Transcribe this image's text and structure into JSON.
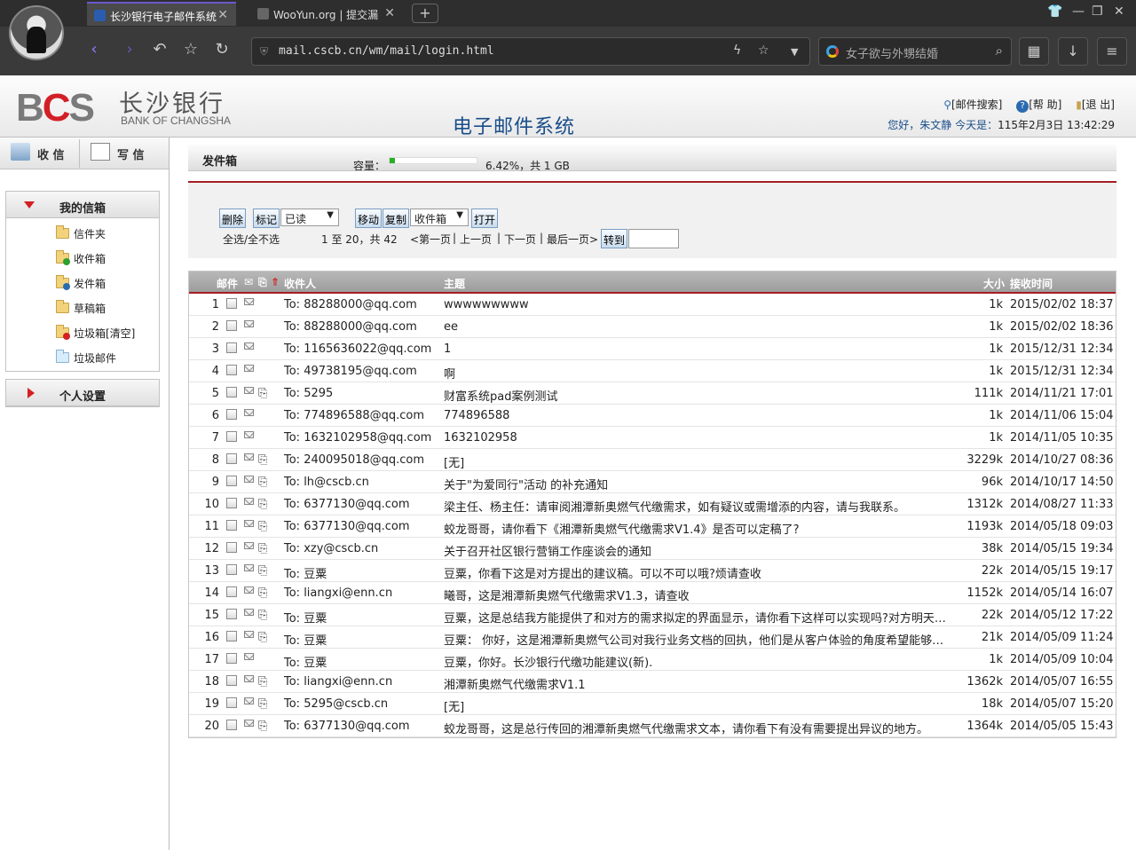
{
  "browser": {
    "tabs": [
      {
        "label": "长沙银行电子邮件系统",
        "active": true
      },
      {
        "label": "WooYun.org | 提交漏",
        "active": false
      }
    ],
    "url": "mail.cscb.cn/wm/mail/login.html",
    "search_placeholder": "女子欲与外甥结婚"
  },
  "header": {
    "logo_cn": "长沙银行",
    "logo_en": "BANK OF CHANGSHA",
    "system_title": "电子邮件系统",
    "links": {
      "search": "[邮件搜索]",
      "help": "[帮 助]",
      "logout": "[退 出]"
    },
    "greeting": "您好，朱文静 今天是：",
    "date": "115年2月3日 13:42:29"
  },
  "sidebar": {
    "receive": "收 信",
    "compose": "写 信",
    "mybox_title": "我的信箱",
    "folders": [
      {
        "label": "信件夹",
        "kind": "yellow"
      },
      {
        "label": "收件箱",
        "kind": "yellow"
      },
      {
        "label": "发件箱",
        "kind": "yellow"
      },
      {
        "label": "草稿箱",
        "kind": "yellow"
      },
      {
        "label": "垃圾箱[清空]",
        "kind": "yellow"
      },
      {
        "label": "垃圾邮件",
        "kind": "blue"
      }
    ],
    "settings_title": "个人设置"
  },
  "main": {
    "box_title": "发件箱",
    "capacity_label": "容量：",
    "capacity_percent": 6.42,
    "capacity_text": "6.42%，共 1 GB",
    "toolbar": {
      "delete": "删除",
      "mark": "标记",
      "mark_value": "已读",
      "move": "移动",
      "copy": "复制",
      "folder_value": "收件箱",
      "open": "打开",
      "select_all": "全选/全不选",
      "range": "1 至 20，共 42",
      "first": "<第一页",
      "prev": "上一页",
      "next": "下一页",
      "last": "最后一页>",
      "goto": "转到"
    },
    "columns": {
      "mail": "邮件",
      "to": "收件人",
      "subject": "主题",
      "size": "大小",
      "time": "接收时间"
    },
    "rows": [
      {
        "n": "1",
        "to": "To: 88288000@qq.com",
        "subject": "wwwwwwwww",
        "size": "1k",
        "time": "2015/02/02 18:37",
        "att": false
      },
      {
        "n": "2",
        "to": "To: 88288000@qq.com",
        "subject": "ee",
        "size": "1k",
        "time": "2015/02/02 18:36",
        "att": false
      },
      {
        "n": "3",
        "to": "To: 1165636022@qq.com",
        "subject": "1",
        "size": "1k",
        "time": "2015/12/31 12:34",
        "att": false
      },
      {
        "n": "4",
        "to": "To: 49738195@qq.com",
        "subject": "啊",
        "size": "1k",
        "time": "2015/12/31 12:34",
        "att": false
      },
      {
        "n": "5",
        "to": "To: 5295",
        "subject": "财富系统pad案例测试",
        "size": "111k",
        "time": "2014/11/21 17:01",
        "att": true
      },
      {
        "n": "6",
        "to": "To: 774896588@qq.com",
        "subject": "774896588",
        "size": "1k",
        "time": "2014/11/06 15:04",
        "att": false
      },
      {
        "n": "7",
        "to": "To: 1632102958@qq.com",
        "subject": "1632102958",
        "size": "1k",
        "time": "2014/11/05 10:35",
        "att": false
      },
      {
        "n": "8",
        "to": "To: 240095018@qq.com",
        "subject": "[无]",
        "size": "3229k",
        "time": "2014/10/27 08:36",
        "att": true
      },
      {
        "n": "9",
        "to": "To: lh@cscb.cn",
        "subject": "关于\"为爱同行\"活动 的补充通知",
        "size": "96k",
        "time": "2014/10/17 14:50",
        "att": true
      },
      {
        "n": "10",
        "to": "To: 6377130@qq.com",
        "subject": "梁主任、杨主任：请审阅湘潭新奥燃气代缴需求，如有疑议或需增添的内容，请与我联系。",
        "size": "1312k",
        "time": "2014/08/27 11:33",
        "att": true
      },
      {
        "n": "11",
        "to": "To: 6377130@qq.com",
        "subject": "蛟龙哥哥，请你看下《湘潭新奥燃气代缴需求V1.4》是否可以定稿了?",
        "size": "1193k",
        "time": "2014/05/18 09:03",
        "att": true
      },
      {
        "n": "12",
        "to": "To: xzy@cscb.cn",
        "subject": "关于召开社区银行营销工作座谈会的通知",
        "size": "38k",
        "time": "2014/05/15 19:34",
        "att": true
      },
      {
        "n": "13",
        "to": "To: 豆粟",
        "subject": "豆粟，你看下这是对方提出的建议稿。可以不可以哦?烦请查收",
        "size": "22k",
        "time": "2014/05/15 19:17",
        "att": true
      },
      {
        "n": "14",
        "to": "To: liangxi@enn.cn",
        "subject": "曦哥，这是湘潭新奥燃气代缴需求V1.3，请查收",
        "size": "1152k",
        "time": "2014/05/14 16:07",
        "att": true
      },
      {
        "n": "15",
        "to": "To: 豆粟",
        "subject": "豆粟，这是总结我方能提供了和对方的需求拟定的界面显示，请你看下这样可以实现吗?对方明天提供阶段性方案",
        "size": "22k",
        "time": "2014/05/12 17:22",
        "att": true
      },
      {
        "n": "16",
        "to": "To: 豆粟",
        "subject": "豆粟： 你好，这是湘潭新奥燃气公司对我行业务文档的回执，他们是从客户体验的角度希望能够在\"学习\"中",
        "size": "21k",
        "time": "2014/05/09 11:24",
        "att": true
      },
      {
        "n": "17",
        "to": "To: 豆粟",
        "subject": "豆粟，你好。长沙银行代缴功能建议(新).",
        "size": "1k",
        "time": "2014/05/09 10:04",
        "att": false
      },
      {
        "n": "18",
        "to": "To: liangxi@enn.cn",
        "subject": "湘潭新奥燃气代缴需求V1.1",
        "size": "1362k",
        "time": "2014/05/07 16:55",
        "att": true
      },
      {
        "n": "19",
        "to": "To: 5295@cscb.cn",
        "subject": "[无]",
        "size": "18k",
        "time": "2014/05/07 15:20",
        "att": true
      },
      {
        "n": "20",
        "to": "To: 6377130@qq.com",
        "subject": "蛟龙哥哥，这是总行传回的湘潭新奥燃气代缴需求文本，请你看下有没有需要提出异议的地方。",
        "size": "1364k",
        "time": "2014/05/05 15:43",
        "att": true
      }
    ]
  },
  "colors": {
    "brand_red": "#d21f26",
    "divider_red": "#a31e24",
    "title_blue": "#1a4e8a",
    "quota_green": "#28b024"
  }
}
